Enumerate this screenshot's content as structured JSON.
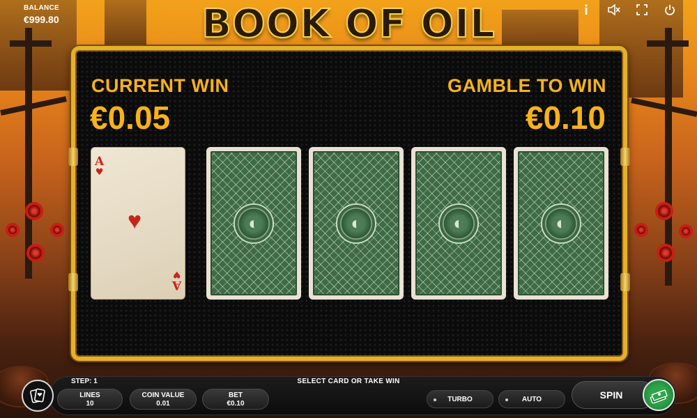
{
  "hud": {
    "balance_label": "BALANCE",
    "balance_value": "€999.80",
    "title": "BOOK OF OIL",
    "icons": [
      "info-icon",
      "sound-muted-icon",
      "fullscreen-icon",
      "power-icon"
    ]
  },
  "gamble": {
    "current_win_label": "CURRENT WIN",
    "current_win_value": "€0.05",
    "gamble_to_win_label": "GAMBLE TO WIN",
    "gamble_to_win_value": "€0.10",
    "revealed_card": {
      "rank": "A",
      "suit": "♥"
    },
    "face_down_cards": 4
  },
  "controls": {
    "step_label": "STEP: 1",
    "hint": "SELECT CARD OR TAKE WIN",
    "lines_label": "LINES",
    "lines_value": "10",
    "coin_value_label": "COIN VALUE",
    "coin_value_value": "0.01",
    "bet_label": "BET",
    "bet_value": "€0.10",
    "turbo_label": "TURBO",
    "auto_label": "AUTO",
    "spin_label": "SPIN"
  },
  "colors": {
    "accent_gold": "#f7b21c",
    "frame_gold": "#e4b12c",
    "card_back_green": "#3e6a45",
    "heart_red": "#c8241a",
    "collect_green": "#2fa54a"
  }
}
